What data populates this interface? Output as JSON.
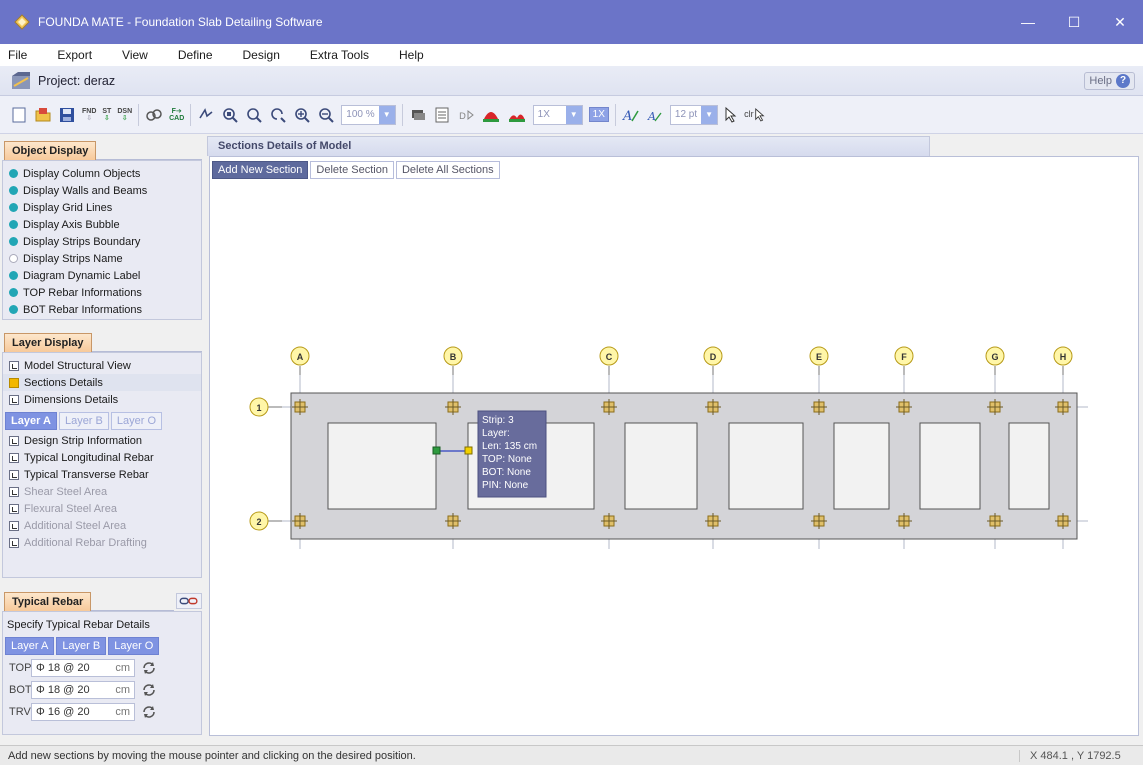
{
  "window": {
    "title": "FOUNDA MATE - Foundation Slab Detailing Software"
  },
  "menu": [
    {
      "label": "File"
    },
    {
      "label": "Export"
    },
    {
      "label": "View"
    },
    {
      "label": "Define"
    },
    {
      "label": "Design"
    },
    {
      "label": "Extra Tools"
    },
    {
      "label": "Help"
    }
  ],
  "project": {
    "title": "Project: deraz",
    "help_label": "Help"
  },
  "toolbar": {
    "fnd_label": "FND",
    "st_label": "ST",
    "dsn_label": "DSN",
    "cad_top": "F",
    "cad_bottom": "CAD",
    "zoom_value": "100 %",
    "scale_value": "1X",
    "scale_badge": "1X",
    "font_size": "12 pt",
    "clear_label": "clr"
  },
  "object_display": {
    "header": "Object Display",
    "items": [
      {
        "label": "Display Column Objects",
        "checked": true
      },
      {
        "label": "Display Walls and Beams",
        "checked": true
      },
      {
        "label": "Display Grid Lines",
        "checked": true
      },
      {
        "label": "Display Axis Bubble",
        "checked": true
      },
      {
        "label": "Display Strips Boundary",
        "checked": true
      },
      {
        "label": "Display Strips Name",
        "checked": false
      },
      {
        "label": "Diagram Dynamic Label",
        "checked": true
      },
      {
        "label": "TOP Rebar Informations",
        "checked": true
      },
      {
        "label": "BOT Rebar Informations",
        "checked": true
      }
    ]
  },
  "layer_display": {
    "header": "Layer Display",
    "views": [
      {
        "label": "Model Structural View"
      },
      {
        "label": "Sections Details"
      },
      {
        "label": "Dimensions Details"
      }
    ],
    "tabs": [
      {
        "label": "Layer A"
      },
      {
        "label": "Layer B"
      },
      {
        "label": "Layer O"
      }
    ],
    "items": [
      {
        "label": "Design Strip Information"
      },
      {
        "label": "Typical Longitudinal Rebar"
      },
      {
        "label": "Typical Transverse Rebar"
      },
      {
        "label": "Shear Steel Area"
      },
      {
        "label": "Flexural Steel Area"
      },
      {
        "label": "Additional Steel Area"
      },
      {
        "label": "Additional Rebar Drafting"
      }
    ]
  },
  "typical_rebar": {
    "header": "Typical Rebar",
    "subtitle": "Specify Typical Rebar Details",
    "tabs": [
      {
        "label": "Layer A"
      },
      {
        "label": "Layer B"
      },
      {
        "label": "Layer O"
      }
    ],
    "rows": [
      {
        "label": "TOP",
        "value": "Φ 18 @ 20",
        "unit": "cm"
      },
      {
        "label": "BOT",
        "value": "Φ 18 @ 20",
        "unit": "cm"
      },
      {
        "label": "TRV",
        "value": "Φ 16 @ 20",
        "unit": "cm"
      }
    ]
  },
  "main": {
    "tab_title": "Sections Details of Model",
    "buttons": {
      "add": "Add New Section",
      "delete": "Delete Section",
      "delete_all": "Delete All Sections"
    },
    "grid_columns": [
      "A",
      "B",
      "C",
      "D",
      "E",
      "F",
      "G",
      "H"
    ],
    "grid_rows": [
      "1",
      "2"
    ],
    "tooltip": {
      "strip": "Strip: 3",
      "layer": "Layer:",
      "len": "Len: 135 cm",
      "top": "TOP: None",
      "bot": "BOT: None",
      "pin": "PIN: None"
    }
  },
  "status": {
    "message": "Add new sections by moving the mouse pointer and clicking on the desired position.",
    "coords": "X 484.1 , Y 1792.5"
  },
  "colors": {
    "titlebar": "#6b74c8",
    "accent": "#7f93e2",
    "slab": "#d4d4d8",
    "bubble": "#fff6a8"
  }
}
